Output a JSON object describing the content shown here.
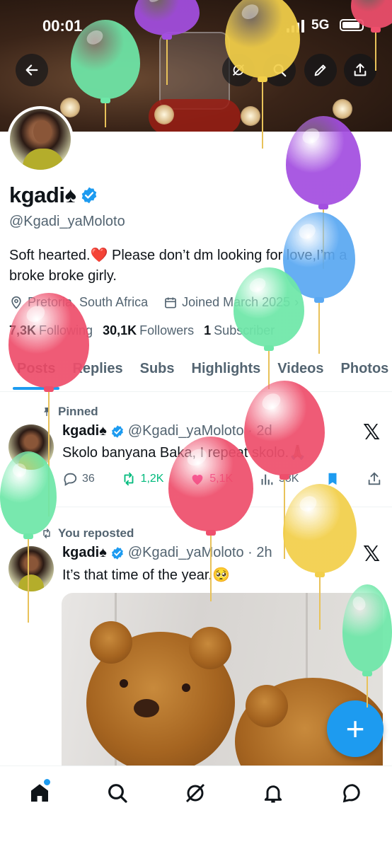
{
  "status_bar": {
    "time": "00:01",
    "network": "5G"
  },
  "header_buttons": [
    "back-arrow-icon",
    "grok-icon",
    "search-icon",
    "edit-icon",
    "share-icon"
  ],
  "profile": {
    "name": "kgadi",
    "name_emoji": "♠",
    "handle": "@Kgadi_yaMoloto",
    "bio": "Soft hearted.❤️ Please don’t dm looking for love,I’m a broke broke girly.",
    "location": "Pretoria, South Africa",
    "joined": "Joined March 2025",
    "following_count": "7,3K",
    "following_label": "Following",
    "followers_count": "30,1K",
    "followers_label": "Followers",
    "subscriber_count": "1",
    "subscriber_label": "Subscriber"
  },
  "tabs": [
    "Posts",
    "Replies",
    "Subs",
    "Highlights",
    "Videos",
    "Photos"
  ],
  "tweets": [
    {
      "context": "Pinned",
      "name": "kgadi♠",
      "handle_time": "@Kgadi_yaMoloto · 2d",
      "text": "Skolo banyana Baka, I repeat skolo.🙏🏾",
      "replies": "36",
      "reposts": "1,2K",
      "likes": "5,1K",
      "views": "38K"
    },
    {
      "context": "You reposted",
      "name": "kgadi♠",
      "handle_time": "@Kgadi_yaMoloto · 2h",
      "text": "It’s that time of the year.🥺"
    }
  ],
  "fab_label": "+",
  "bottom_nav": [
    "home-icon",
    "search-icon",
    "grok-icon",
    "notifications-icon",
    "messages-icon"
  ],
  "colors": {
    "accent": "#1d9bf0",
    "text": "#0f1419",
    "secondary": "#536471",
    "repost_green": "#00ba7c",
    "like_pink": "#f91880",
    "balloon_green": "#6ee7a8",
    "balloon_purple": "#a34ee0",
    "balloon_yellow": "#f2cf4a",
    "balloon_blue": "#5aa8f2",
    "balloon_red": "#ee4f6c"
  }
}
